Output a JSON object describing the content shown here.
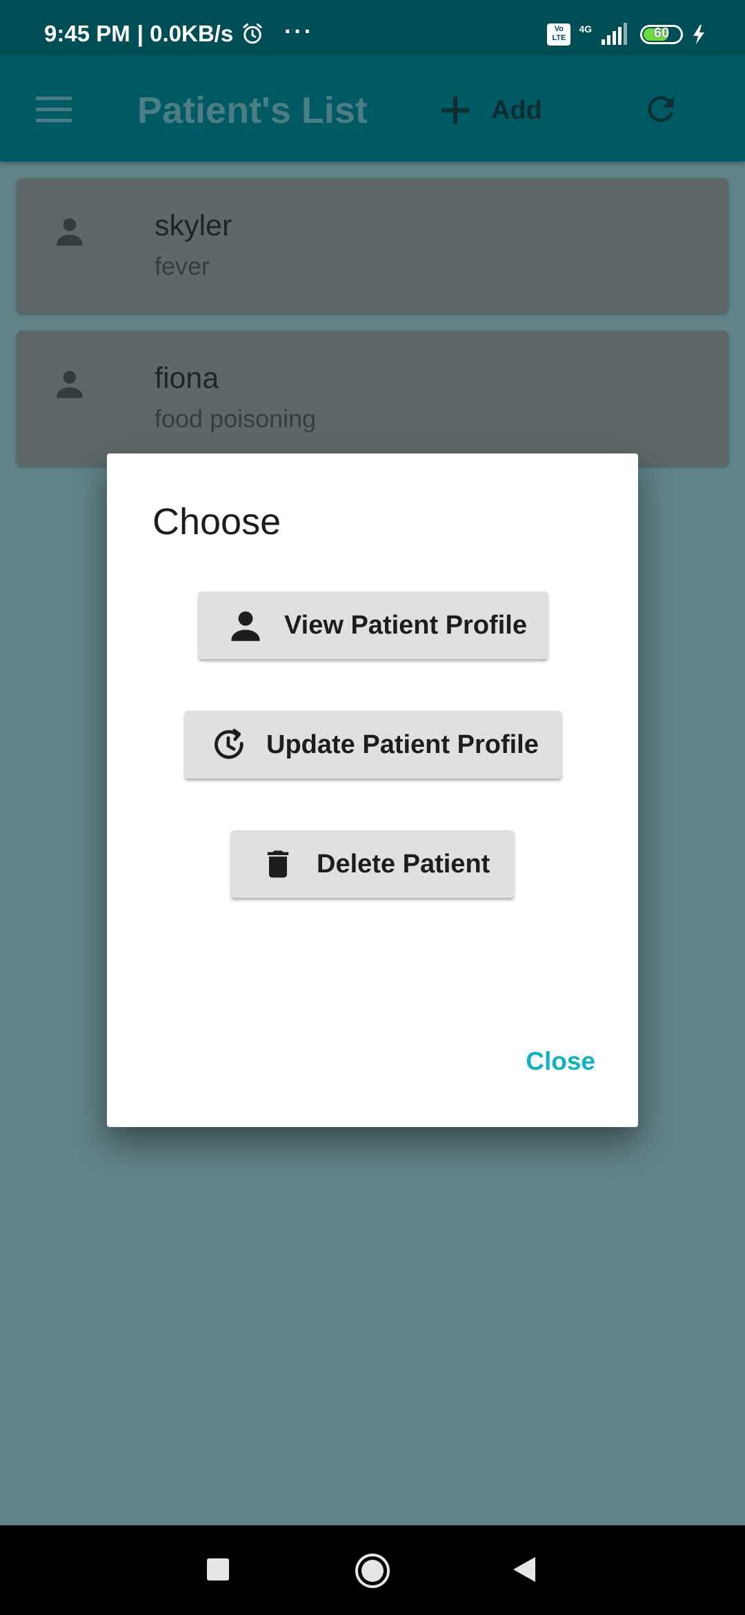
{
  "status_bar": {
    "time": "9:45 PM",
    "speed": "| 0.0KB/s",
    "overflow": "···",
    "volte_label": "Vo LTE",
    "network_label": "4G",
    "battery_level": "60",
    "icons": [
      "alarm-icon",
      "signal-icon",
      "battery-icon",
      "charging-icon"
    ]
  },
  "app_bar": {
    "title": "Patient's List",
    "add_label": "Add",
    "icons": [
      "menu-icon",
      "plus-icon",
      "refresh-icon"
    ],
    "background": "#005a63"
  },
  "patients": [
    {
      "name": "skyler",
      "condition": "fever"
    },
    {
      "name": "fiona",
      "condition": "food poisoning"
    }
  ],
  "dialog": {
    "title": "Choose",
    "buttons": [
      {
        "label": "View Patient Profile",
        "icon": "person-icon"
      },
      {
        "label": "Update Patient Profile",
        "icon": "history-icon"
      },
      {
        "label": "Delete Patient",
        "icon": "delete-icon"
      }
    ],
    "close_label": "Close",
    "accent": "#0fb1c7"
  },
  "nav_bar": {
    "icons": [
      "recents-square-icon",
      "home-circle-icon",
      "back-triangle-icon"
    ]
  }
}
